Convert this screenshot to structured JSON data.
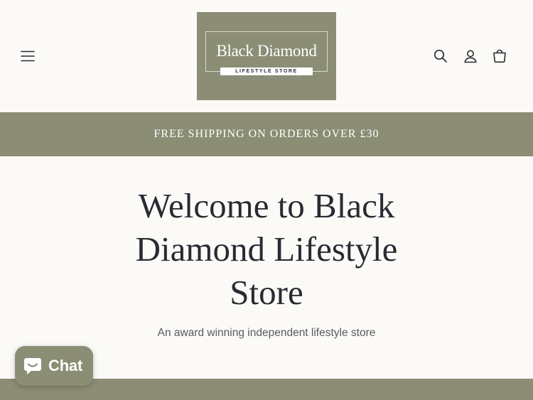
{
  "header": {
    "menu_icon": "hamburger-menu-icon",
    "logo": {
      "name": "Black Diamond",
      "tagline": "LIFESTYLE STORE",
      "background_color": "#8b8d75"
    },
    "icons": [
      "search-icon",
      "account-icon",
      "cart-icon"
    ]
  },
  "announcement": {
    "text": "FREE SHIPPING ON ORDERS OVER £30",
    "background_color": "#8b8d75"
  },
  "hero": {
    "title": "Welcome to Black Diamond Lifestyle Store",
    "subtitle": "An award winning independent lifestyle store"
  },
  "chat_widget": {
    "label": "Chat",
    "icon": "chat-bubble-icon"
  },
  "colors": {
    "accent": "#8b8d75",
    "background": "#fbfaf7",
    "text": "#2b2a33"
  }
}
